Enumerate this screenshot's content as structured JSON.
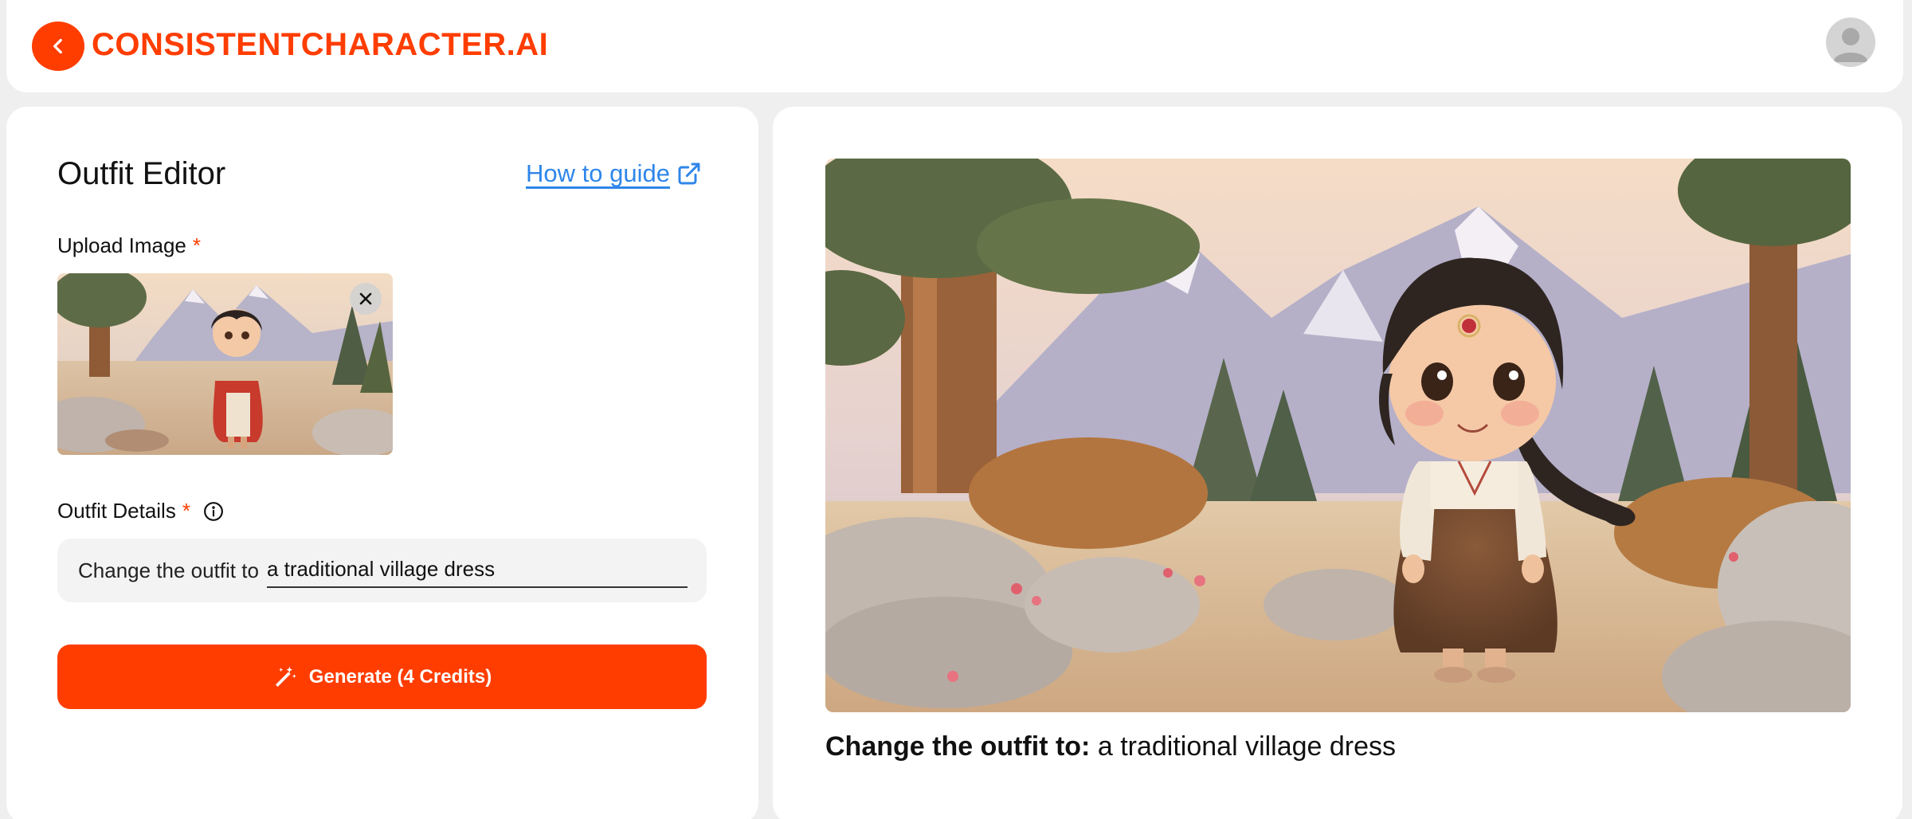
{
  "header": {
    "brand": "CONSISTENTCHARACTER.AI",
    "accent_color": "#ff3d00",
    "back_icon": "chevron-left-icon",
    "avatar_icon": "user-avatar-icon"
  },
  "editor": {
    "title": "Outfit Editor",
    "guide_link": "How to guide",
    "guide_icon": "external-link-icon",
    "upload_label": "Upload Image",
    "required_mark": "*",
    "outfit_label": "Outfit Details",
    "info_icon": "info-icon",
    "prompt_prefix": "Change the outfit to",
    "prompt_value": "a traditional village dress",
    "generate_label": "Generate (4 Credits)",
    "generate_icon": "magic-wand-icon"
  },
  "result": {
    "caption_label": "Change the outfit to:",
    "caption_value": "a traditional village dress"
  }
}
